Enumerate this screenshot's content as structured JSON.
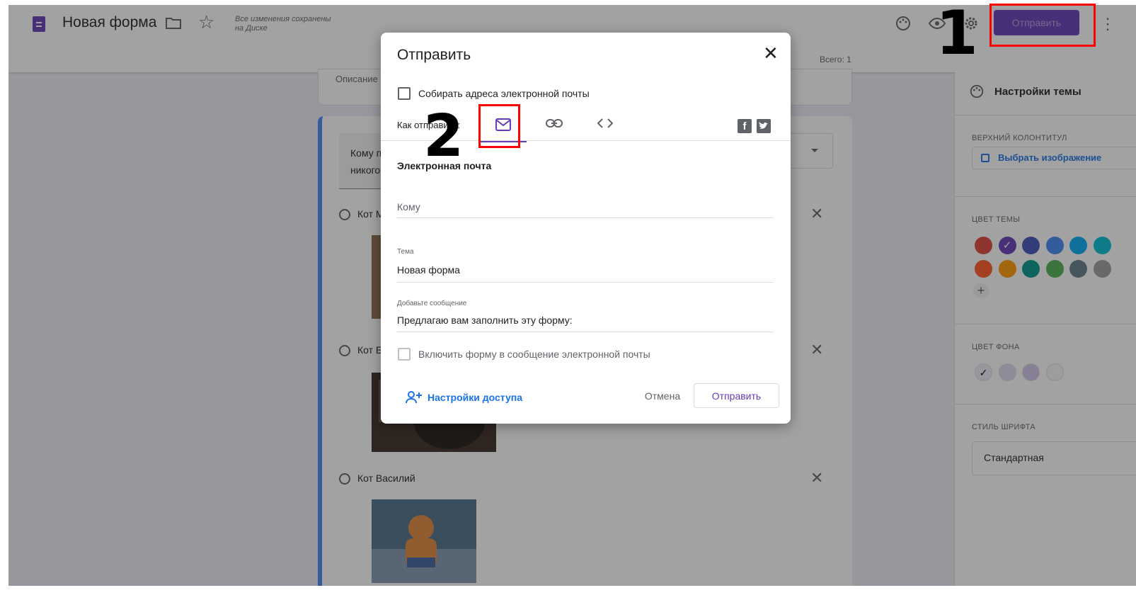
{
  "header": {
    "form_title": "Новая форма",
    "saved_line1": "Все изменения сохранены",
    "saved_line2": "на Диске",
    "send_label": "Отправить",
    "total": "Всего: 1"
  },
  "form": {
    "description": "Описание",
    "question_line1": "Кому п",
    "question_line2": "никого",
    "options": [
      "Кот М",
      "Кот Б",
      "Кот Василий"
    ]
  },
  "sidebar": {
    "title": "Настройки темы",
    "header_label": "ВЕРХНИЙ КОЛОНТИТУЛ",
    "choose_image": "Выбрать изображение",
    "theme_color_label": "ЦВЕТ ТЕМЫ",
    "theme_colors": [
      "#db4437",
      "#673ab7",
      "#3f51b5",
      "#4285f4",
      "#03a9f4",
      "#00bcd4",
      "#ff5722",
      "#ff9800",
      "#009688",
      "#4caf50",
      "#607d8b",
      "#9e9e9e"
    ],
    "bg_color_label": "ЦВЕТ ФОНА",
    "bg_colors": [
      "#f0ebf8",
      "#e1d8f1",
      "#d1c4e9",
      "#f6f6f6"
    ],
    "font_style_label": "СТИЛЬ ШРИФТА",
    "font_style_value": "Стандартная"
  },
  "dialog": {
    "title": "Отправить",
    "collect_emails": "Собирать адреса электронной почты",
    "how_to_send": "Как отправить:",
    "section_title": "Электронная почта",
    "to_placeholder": "Кому",
    "subject_label": "Тема",
    "subject_value": "Новая форма",
    "message_label": "Добавьте сообщение",
    "message_value": "Предлагаю вам заполнить эту форму:",
    "include_form": "Включить форму в сообщение электронной почты",
    "access_settings": "Настройки доступа",
    "cancel": "Отмена",
    "send": "Отправить",
    "facebook": "f"
  },
  "annotations": {
    "step1": "1",
    "step2": "2"
  }
}
